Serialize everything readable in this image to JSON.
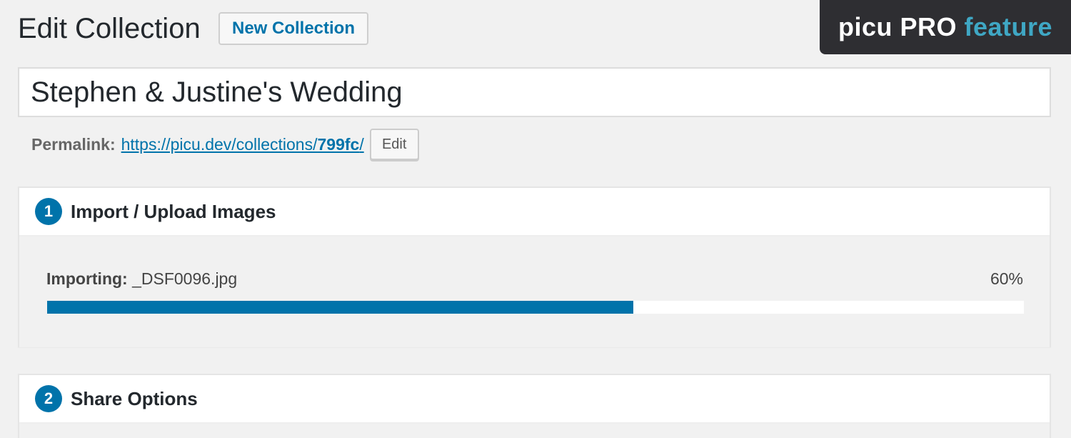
{
  "header": {
    "title": "Edit Collection",
    "new_button_label": "New Collection"
  },
  "badge": {
    "part1": "picu PRO",
    "part2": "feature"
  },
  "collection": {
    "title": "Stephen & Justine's Wedding"
  },
  "permalink": {
    "label": "Permalink:",
    "url_prefix": "https://picu.dev/collections/",
    "url_slug": "799fc",
    "url_suffix": "/",
    "edit_label": "Edit"
  },
  "steps": [
    {
      "number": "1",
      "title": "Import / Upload Images",
      "import_label": "Importing:",
      "import_file": "_DSF0096.jpg",
      "percent_text": "60%",
      "progress": 0.6
    },
    {
      "number": "2",
      "title": "Share Options"
    }
  ],
  "colors": {
    "accent": "#0073aa",
    "badge_bg": "#2e2e32",
    "badge_highlight": "#3fa7c4",
    "page_bg": "#f1f1f1"
  }
}
